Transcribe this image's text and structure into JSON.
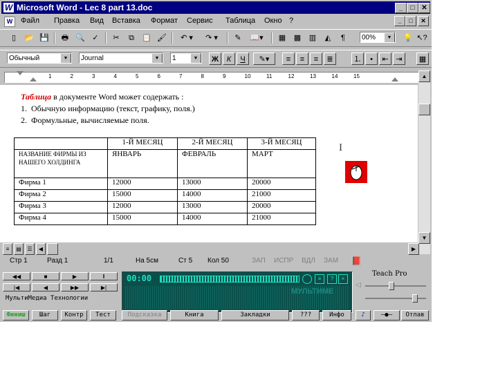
{
  "window": {
    "title": "Microsoft Word - Lec 8  part 13.doc",
    "logo_letter": "W",
    "controls": [
      "_",
      "□",
      "✕"
    ],
    "doc_controls": [
      "_",
      "□",
      "✕"
    ]
  },
  "menubar": {
    "items": [
      "Файл",
      "Правка",
      "Вид",
      "Вставка",
      "Формат",
      "Сервис",
      "Таблица",
      "Окно",
      "?"
    ]
  },
  "toolbar": {
    "zoom": "00%"
  },
  "format_bar": {
    "style": "Обычный",
    "font": "Journal",
    "size": "1",
    "bold": "Ж",
    "italic": "К",
    "underline": "Ч"
  },
  "ruler": {
    "numbers": [
      "1",
      "2",
      "3",
      "4",
      "5",
      "6",
      "7",
      "8",
      "9",
      "10",
      "11",
      "12",
      "13",
      "14",
      "15"
    ]
  },
  "document": {
    "intro_highlight": "Таблица",
    "intro_rest": " в документе  Word может содержать :",
    "list": [
      {
        "num": "1.",
        "text": "Обычную информацию (текст,  графику,  поля.)"
      },
      {
        "num": "2.",
        "text": "Формульные,  вычисляемые поля."
      }
    ],
    "table": {
      "header": [
        "",
        "1-Й МЕСЯЦ",
        "2-Й МЕСЯЦ",
        "3-Й МЕСЯЦ"
      ],
      "subheader": [
        "НАЗВАНИЕ ФИРМЫ ИЗ НАШЕГО ХОЛДИНГА",
        "ЯНВАРЬ",
        "ФЕВРАЛЬ",
        "МАРТ"
      ],
      "rows": [
        [
          "Фирма 1",
          "12000",
          "13000",
          "20000"
        ],
        [
          "Фирма 2",
          "15000",
          "14000",
          "21000"
        ],
        [
          "Фирма 3",
          "12000",
          "13000",
          "20000"
        ],
        [
          "Фирма 4",
          "15000",
          "14000",
          "21000"
        ]
      ]
    }
  },
  "statusbar": {
    "page": "Стр  1",
    "section": "Разд  1",
    "pages": "1/1",
    "at": "На  5см",
    "line": "Ст  5",
    "col": "Кол  50",
    "rec": "ЗАП",
    "trk": "ИСПР",
    "ext": "ВДЛ",
    "ovr": "ЗАМ"
  },
  "multimedia": {
    "time": "00:00",
    "brand": "МультиМедиа  Технологии",
    "watermark": "МУЛЬТИМЕ",
    "teach_pro": "Teach Pro",
    "buttons": [
      "Финиш",
      "Шаг",
      "Контр",
      "Тест"
    ],
    "nav": [
      "Подсказка",
      "Книга",
      "Закладки",
      "???",
      "Инфо"
    ],
    "exit": "Отлав"
  },
  "colors": {
    "title_bg": "#000080",
    "highlight": "#d00000",
    "lcd": "#0a4f4a",
    "led": "#20e0c0"
  }
}
